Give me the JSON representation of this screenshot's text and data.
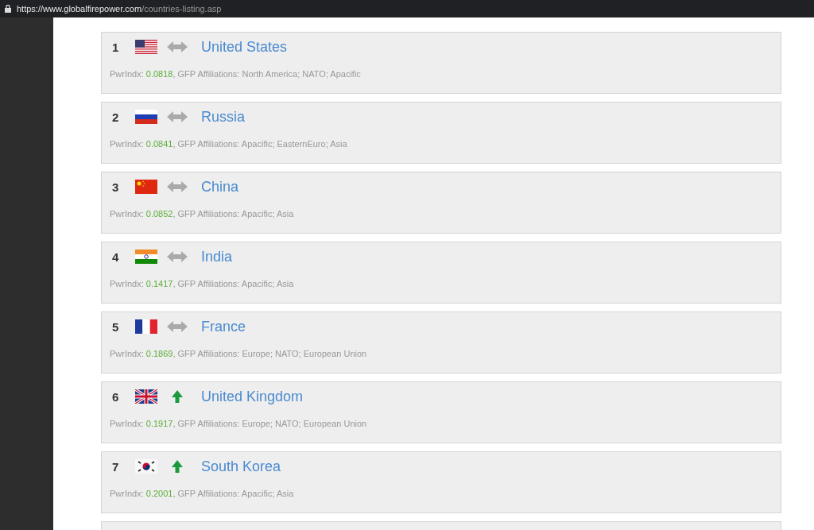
{
  "address_bar": {
    "domain": "https://www.globalfirepower.com",
    "path": "/countries-listing.asp"
  },
  "countries": [
    {
      "rank": "1",
      "flag": {
        "kind": "us"
      },
      "trend": {
        "kind": "same"
      },
      "name": "United States",
      "pwrindx_label": "PwrIndx:",
      "pwrindx": "0.0818",
      "affiliations": ", GFP Affiliations: North America; NATO; Apacific"
    },
    {
      "rank": "2",
      "flag": {
        "kind": "ru"
      },
      "trend": {
        "kind": "same"
      },
      "name": "Russia",
      "pwrindx_label": "PwrIndx:",
      "pwrindx": "0.0841",
      "affiliations": ", GFP Affiliations: Apacific; EasternEuro; Asia"
    },
    {
      "rank": "3",
      "flag": {
        "kind": "cn"
      },
      "trend": {
        "kind": "same"
      },
      "name": "China",
      "pwrindx_label": "PwrIndx:",
      "pwrindx": "0.0852",
      "affiliations": ", GFP Affiliations: Apacific; Asia"
    },
    {
      "rank": "4",
      "flag": {
        "kind": "in"
      },
      "trend": {
        "kind": "same"
      },
      "name": "India",
      "pwrindx_label": "PwrIndx:",
      "pwrindx": "0.1417",
      "affiliations": ", GFP Affiliations: Apacific; Asia"
    },
    {
      "rank": "5",
      "flag": {
        "kind": "fr"
      },
      "trend": {
        "kind": "same"
      },
      "name": "France",
      "pwrindx_label": "PwrIndx:",
      "pwrindx": "0.1869",
      "affiliations": ", GFP Affiliations: Europe; NATO; European Union"
    },
    {
      "rank": "6",
      "flag": {
        "kind": "gb"
      },
      "trend": {
        "kind": "up"
      },
      "name": "United Kingdom",
      "pwrindx_label": "PwrIndx:",
      "pwrindx": "0.1917",
      "affiliations": ", GFP Affiliations: Europe; NATO; European Union"
    },
    {
      "rank": "7",
      "flag": {
        "kind": "kr"
      },
      "trend": {
        "kind": "up"
      },
      "name": "South Korea",
      "pwrindx_label": "PwrIndx:",
      "pwrindx": "0.2001",
      "affiliations": ", GFP Affiliations: Apacific; Asia"
    }
  ]
}
